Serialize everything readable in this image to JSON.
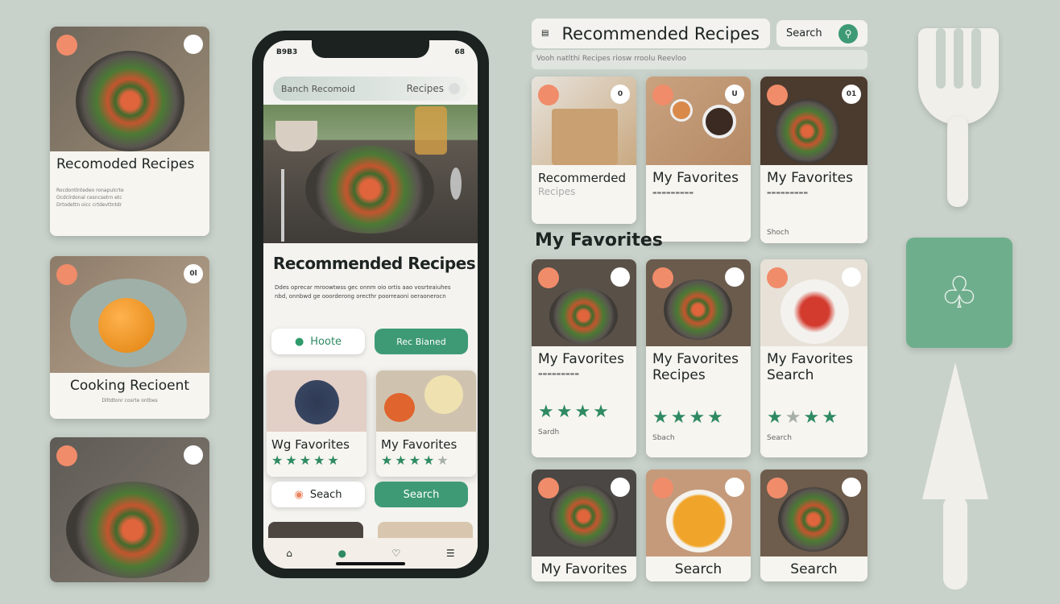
{
  "colors": {
    "background": "#c8d2ca",
    "accent": "#3e9a75",
    "badge": "#f08c6a"
  },
  "left_cards": [
    {
      "title": "Recomoded Recipes",
      "badge": "",
      "badge_r": "",
      "lines": [
        "Rocdontlntedeo ronapulcrte",
        "Ocdclrdonal cesncsetrn etc",
        "Drtodettn oicc crtdevttntdr"
      ]
    },
    {
      "title": "Cooking Recioent",
      "badge": "",
      "badge_r": "0l",
      "lines": [
        "Dlltdtonr cosrte ontbes"
      ]
    },
    {
      "title": "",
      "badge": "",
      "badge_r": ""
    }
  ],
  "phone": {
    "status_left": "B9B3",
    "status_right": "68",
    "search_value": "Banch  Recomoid",
    "search_tag": "Recipes",
    "hero_title": "Recommended Recipes",
    "hero_text": "Ddes oprecar mroowtwss gec onnm oio ortis aao vosrteaiuhes nbd, onnbwd ge ooorderong orecthr poorreaoni oeraonerocn",
    "btn_home": "Hoote",
    "btn_green": "Rec Bianed",
    "cards": [
      {
        "title": "Wg Favorites",
        "rating": 5
      },
      {
        "title": "My Favorites",
        "rating": 4
      }
    ],
    "btn_search_1": "Seach",
    "btn_search_2": "Search",
    "nav": [
      "home-icon",
      "recipes-icon",
      "favorites-icon",
      "profile-icon"
    ]
  },
  "grid": {
    "header_title": "Recommended Recipes",
    "search_label": "Search",
    "subtitle": "Vooh natlthi Recipes riosw rroolu Reevloo",
    "row1": [
      {
        "title": "Recommerded",
        "sub": "Recipes",
        "badge_r": "0",
        "footer": ""
      },
      {
        "title": "My Favorites",
        "sub": "",
        "badge_r": "U",
        "footer": ""
      },
      {
        "title": "My Favorites",
        "sub": "",
        "badge_r": "01",
        "footer": "Shoch"
      }
    ],
    "section_title": "My Favorites",
    "row2": [
      {
        "title": "My Favorites",
        "sub": "",
        "rating": 4,
        "footer": "Sardh"
      },
      {
        "title": "My Favorites Recipes",
        "sub": "",
        "rating": 4,
        "footer": "Sbach"
      },
      {
        "title": "My Favorites Search",
        "sub": "",
        "rating": 3,
        "footer": "Search"
      }
    ],
    "row3": [
      {
        "title": "My Favorites"
      },
      {
        "title": "Search"
      },
      {
        "title": "Search"
      }
    ]
  }
}
